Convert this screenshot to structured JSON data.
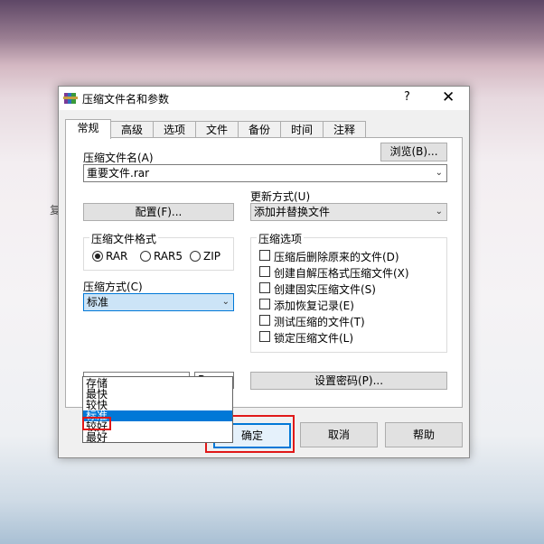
{
  "background": {
    "stray_char": "复"
  },
  "window": {
    "title": "压缩文件名和参数",
    "help_label": "?",
    "close_label": "✕",
    "icon": "winrar-books-icon"
  },
  "tabs": [
    {
      "label": "常规",
      "active": true
    },
    {
      "label": "高级",
      "active": false
    },
    {
      "label": "选项",
      "active": false
    },
    {
      "label": "文件",
      "active": false
    },
    {
      "label": "备份",
      "active": false
    },
    {
      "label": "时间",
      "active": false
    },
    {
      "label": "注释",
      "active": false
    }
  ],
  "general": {
    "archive_name_label": "压缩文件名(A)",
    "browse_label": "浏览(B)...",
    "archive_name_value": "重要文件.rar",
    "update_mode_label": "更新方式(U)",
    "update_mode_value": "添加并替换文件",
    "profile_label": "配置(F)...",
    "format_group_title": "压缩文件格式",
    "formats": [
      {
        "label": "RAR",
        "selected": true
      },
      {
        "label": "RAR5",
        "selected": false
      },
      {
        "label": "ZIP",
        "selected": false
      }
    ],
    "method_label": "压缩方式(C)",
    "method_value": "标准",
    "method_options": [
      "存储",
      "最快",
      "较快",
      "标准",
      "较好",
      "最好"
    ],
    "method_highlighted": "标准",
    "split_unit_value": "B",
    "options_group_title": "压缩选项",
    "options": [
      {
        "label": "压缩后删除原来的文件(D)",
        "checked": false
      },
      {
        "label": "创建自解压格式压缩文件(X)",
        "checked": false
      },
      {
        "label": "创建固实压缩文件(S)",
        "checked": false
      },
      {
        "label": "添加恢复记录(E)",
        "checked": false
      },
      {
        "label": "测试压缩的文件(T)",
        "checked": false
      },
      {
        "label": "锁定压缩文件(L)",
        "checked": false
      }
    ],
    "password_label": "设置密码(P)..."
  },
  "buttons": {
    "ok_label": "确定",
    "cancel_label": "取消",
    "help_label": "帮助"
  },
  "colors": {
    "selection": "#0078d7",
    "highlight_annotation": "#e01818"
  }
}
